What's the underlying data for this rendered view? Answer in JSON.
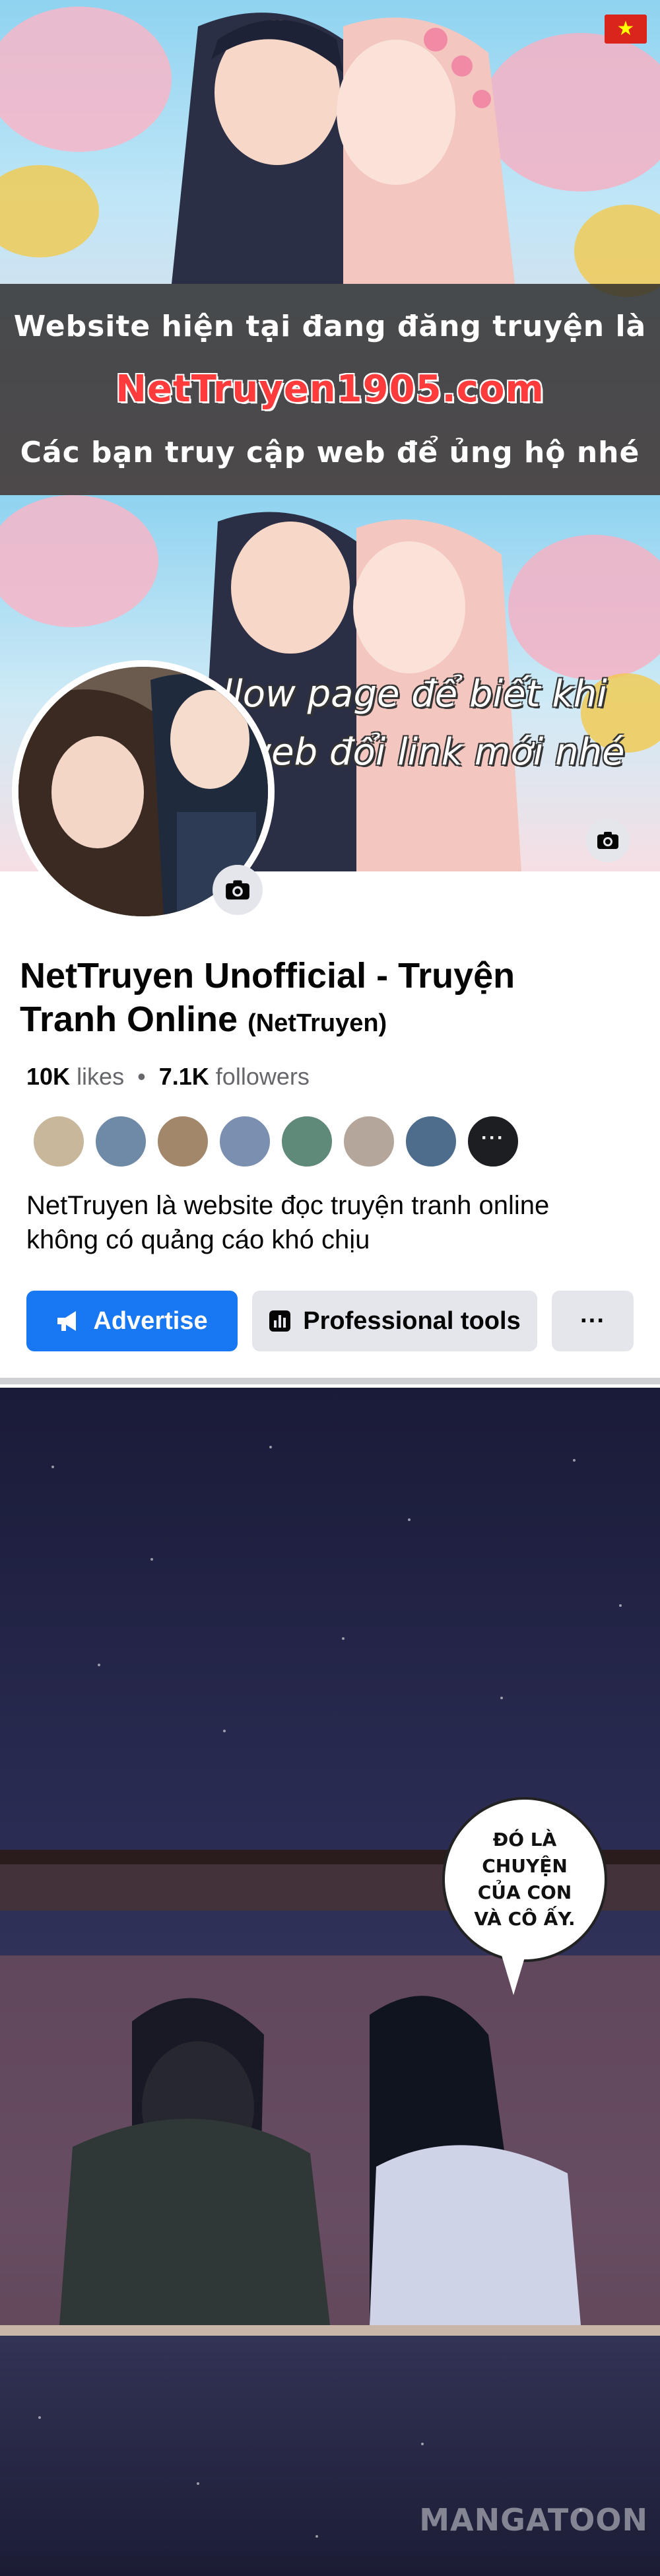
{
  "banner": {
    "line1": "Website hiện tại đang đăng truyện là",
    "line2": "NetTruyen1905.com",
    "line3": "Các bạn truy cập web để ủng hộ nhé",
    "flag_icon": "vietnam-flag-icon"
  },
  "page": {
    "cover_text": "Follow page để biết khi nào web đổi link mới nhé",
    "name": "NetTruyen Unofficial - Truyện Tranh Online",
    "handle": "(NetTruyen)",
    "likes_count": "10K",
    "likes_label": "likes",
    "separator": "•",
    "followers_count": "7.1K",
    "followers_label": "followers",
    "description": "NetTruyen là website đọc truyện tranh online không có quảng cáo khó chịu",
    "more_friends": "···"
  },
  "buttons": {
    "advertise": "Advertise",
    "professional_tools": "Professional tools",
    "more": "···"
  },
  "manga": {
    "speech": "ĐÓ LÀ CHUYỆN CỦA CON VÀ CÔ ẤY.",
    "watermark": "MANGATOON"
  },
  "colors": {
    "facebook_blue": "#1877f2",
    "button_gray": "#e4e6eb",
    "banner_overlay": "#282828"
  }
}
